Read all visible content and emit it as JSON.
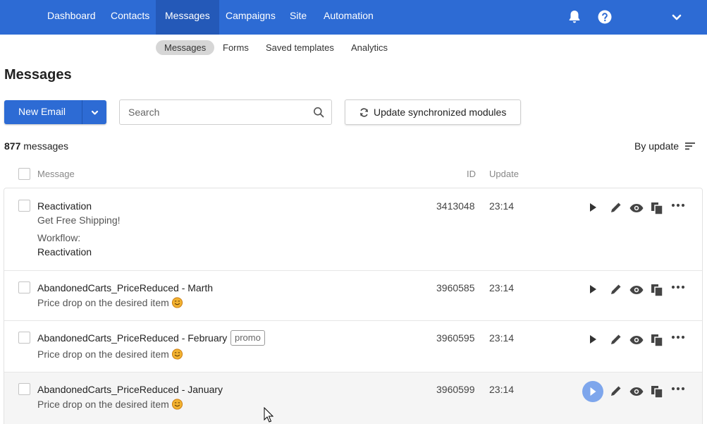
{
  "top_nav": {
    "items": [
      "Dashboard",
      "Contacts",
      "Messages",
      "Campaigns",
      "Site",
      "Automation"
    ],
    "active": "Messages"
  },
  "sub_nav": {
    "items": [
      "Messages",
      "Forms",
      "Saved templates",
      "Analytics"
    ],
    "active": "Messages"
  },
  "page": {
    "title": "Messages"
  },
  "toolbar": {
    "new_email_label": "New Email",
    "search_placeholder": "Search",
    "sync_label": "Update synchronized modules"
  },
  "summary": {
    "count": "877",
    "count_suffix": "messages",
    "sort_label": "By update"
  },
  "columns": {
    "message": "Message",
    "id": "ID",
    "update": "Update"
  },
  "rows": [
    {
      "title": "Reactivation",
      "subtitle": "Get Free Shipping!",
      "meta_label": "Workflow:",
      "meta_value": "Reactivation",
      "id": "3413048",
      "update": "23:14"
    },
    {
      "title": "AbandonedCarts_PriceReduced - Marth",
      "subtitle": "Price drop on the desired item",
      "id": "3960585",
      "update": "23:14"
    },
    {
      "title": "AbandonedCarts_PriceReduced - February",
      "badge": "promo",
      "subtitle": "Price drop on the desired item",
      "id": "3960595",
      "update": "23:14"
    },
    {
      "title": "AbandonedCarts_PriceReduced - January",
      "subtitle": "Price drop on the desired item",
      "id": "3960599",
      "update": "23:14"
    }
  ],
  "icons": {
    "row_actions": [
      "play-icon",
      "pencil-icon",
      "eye-icon",
      "copy-icon",
      "more-icon"
    ],
    "emoji": "smiling-face-emoji"
  },
  "colors": {
    "brand": "#2d6bd4",
    "brand_dark": "#2459b8",
    "play_highlight": "#7ea6ec"
  }
}
